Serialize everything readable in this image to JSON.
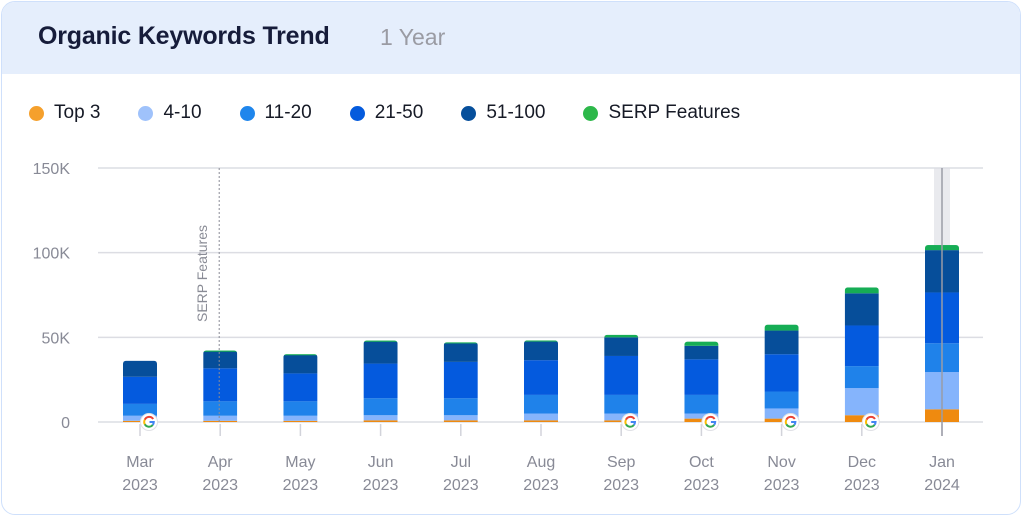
{
  "header": {
    "title": "Organic Keywords Trend",
    "period": "1 Year"
  },
  "legend": [
    {
      "label": "Top 3",
      "color": "#f5a02c"
    },
    {
      "label": "4-10",
      "color": "#9fc2fb"
    },
    {
      "label": "11-20",
      "color": "#1f86ec"
    },
    {
      "label": "21-50",
      "color": "#045bdd"
    },
    {
      "label": "51-100",
      "color": "#064f9b"
    },
    {
      "label": "SERP Features",
      "color": "#2db84a"
    }
  ],
  "chart_data": {
    "type": "bar",
    "stacked": true,
    "title": "Organic Keywords Trend",
    "xlabel": "",
    "ylabel": "",
    "ylim": [
      0,
      150000
    ],
    "yticks": [
      0,
      50000,
      100000,
      150000
    ],
    "ytick_labels": [
      "0",
      "50K",
      "100K",
      "150K"
    ],
    "grid": true,
    "legend_position": "top-left",
    "categories": [
      [
        "Mar",
        "2023"
      ],
      [
        "Apr",
        "2023"
      ],
      [
        "May",
        "2023"
      ],
      [
        "Jun",
        "2023"
      ],
      [
        "Jul",
        "2023"
      ],
      [
        "Aug",
        "2023"
      ],
      [
        "Sep",
        "2023"
      ],
      [
        "Oct",
        "2023"
      ],
      [
        "Nov",
        "2023"
      ],
      [
        "Dec",
        "2023"
      ],
      [
        "Jan",
        "2024"
      ]
    ],
    "series": [
      {
        "name": "Top 3",
        "color": "#ef8a0f",
        "values": [
          700,
          700,
          700,
          1000,
          1000,
          1000,
          1000,
          2000,
          2000,
          4000,
          7500
        ]
      },
      {
        "name": "4-10",
        "color": "#85b4fc",
        "values": [
          3000,
          3000,
          3000,
          3000,
          3000,
          4000,
          4000,
          3000,
          6000,
          16000,
          22000
        ]
      },
      {
        "name": "11-20",
        "color": "#1f82ea",
        "values": [
          7000,
          8500,
          8500,
          10000,
          10000,
          11000,
          11000,
          11000,
          10000,
          13000,
          17000
        ]
      },
      {
        "name": "21-50",
        "color": "#045ade",
        "values": [
          16000,
          19500,
          16500,
          20500,
          21500,
          20500,
          23000,
          21000,
          22000,
          24000,
          30000
        ]
      },
      {
        "name": "51-100",
        "color": "#064e9a",
        "values": [
          9500,
          10000,
          11000,
          13000,
          11000,
          11000,
          11000,
          8000,
          14000,
          19000,
          25000
        ]
      },
      {
        "name": "SERP Features",
        "color": "#16ad55",
        "values": [
          0,
          500,
          400,
          600,
          600,
          700,
          1500,
          2500,
          3500,
          3500,
          3000
        ]
      }
    ],
    "annotations": [
      {
        "type": "vertical-line",
        "category": "Apr 2023",
        "label": "SERP Features",
        "style": "dotted"
      },
      {
        "type": "google-update-marker",
        "categories": [
          "Mar 2023",
          "Sep 2023",
          "Oct 2023",
          "Nov 2023",
          "Dec 2023"
        ]
      },
      {
        "type": "hover-highlight",
        "category": "Jan 2024"
      }
    ]
  }
}
